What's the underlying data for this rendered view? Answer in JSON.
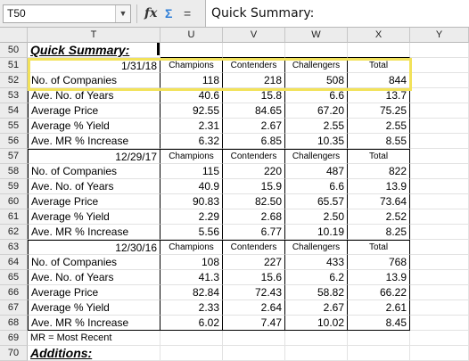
{
  "formula_bar": {
    "name_box": "T50",
    "content": "Quick Summary:",
    "icons": [
      "function-icon",
      "autosum-icon",
      "equals-icon"
    ]
  },
  "columns": [
    "T",
    "U",
    "V",
    "W",
    "X",
    "Y"
  ],
  "rows": [
    {
      "num": "50",
      "type": "title",
      "label": "Quick Summary:"
    },
    {
      "num": "51",
      "type": "header",
      "date": "1/31/18",
      "cols": [
        "Champions",
        "Contenders",
        "Challengers",
        "Total"
      ]
    },
    {
      "num": "52",
      "type": "data",
      "label": "No. of Companies",
      "vals": [
        "118",
        "218",
        "508",
        "844"
      ]
    },
    {
      "num": "53",
      "type": "data",
      "label": "Ave. No. of Years",
      "vals": [
        "40.6",
        "15.8",
        "6.6",
        "13.7"
      ]
    },
    {
      "num": "54",
      "type": "data",
      "label": "Average Price",
      "vals": [
        "92.55",
        "84.65",
        "67.20",
        "75.25"
      ]
    },
    {
      "num": "55",
      "type": "data",
      "label": "Average % Yield",
      "vals": [
        "2.31",
        "2.67",
        "2.55",
        "2.55"
      ]
    },
    {
      "num": "56",
      "type": "data",
      "label": "Ave. MR % Increase",
      "vals": [
        "6.32",
        "6.85",
        "10.35",
        "8.55"
      ]
    },
    {
      "num": "57",
      "type": "header",
      "date": "12/29/17",
      "cols": [
        "Champions",
        "Contenders",
        "Challengers",
        "Total"
      ]
    },
    {
      "num": "58",
      "type": "data",
      "label": "No. of Companies",
      "vals": [
        "115",
        "220",
        "487",
        "822"
      ]
    },
    {
      "num": "59",
      "type": "data",
      "label": "Ave. No. of Years",
      "vals": [
        "40.9",
        "15.9",
        "6.6",
        "13.9"
      ]
    },
    {
      "num": "60",
      "type": "data",
      "label": "Average Price",
      "vals": [
        "90.83",
        "82.50",
        "65.57",
        "73.64"
      ]
    },
    {
      "num": "61",
      "type": "data",
      "label": "Average % Yield",
      "vals": [
        "2.29",
        "2.68",
        "2.50",
        "2.52"
      ]
    },
    {
      "num": "62",
      "type": "data",
      "label": "Ave. MR % Increase",
      "vals": [
        "5.56",
        "6.77",
        "10.19",
        "8.25"
      ]
    },
    {
      "num": "63",
      "type": "header",
      "date": "12/30/16",
      "cols": [
        "Champions",
        "Contenders",
        "Challengers",
        "Total"
      ]
    },
    {
      "num": "64",
      "type": "data",
      "label": "No. of Companies",
      "vals": [
        "108",
        "227",
        "433",
        "768"
      ]
    },
    {
      "num": "65",
      "type": "data",
      "label": "Ave. No. of Years",
      "vals": [
        "41.3",
        "15.6",
        "6.2",
        "13.9"
      ]
    },
    {
      "num": "66",
      "type": "data",
      "label": "Average Price",
      "vals": [
        "82.84",
        "72.43",
        "58.82",
        "66.22"
      ]
    },
    {
      "num": "67",
      "type": "data",
      "label": "Average % Yield",
      "vals": [
        "2.33",
        "2.64",
        "2.67",
        "2.61"
      ]
    },
    {
      "num": "68",
      "type": "data",
      "label": "Ave. MR % Increase",
      "vals": [
        "6.02",
        "7.47",
        "10.02",
        "8.45"
      ]
    },
    {
      "num": "69",
      "type": "note",
      "label": "MR = Most Recent"
    },
    {
      "num": "70",
      "type": "title",
      "label": "Additions:"
    }
  ],
  "highlight_color": "#f2e25a"
}
